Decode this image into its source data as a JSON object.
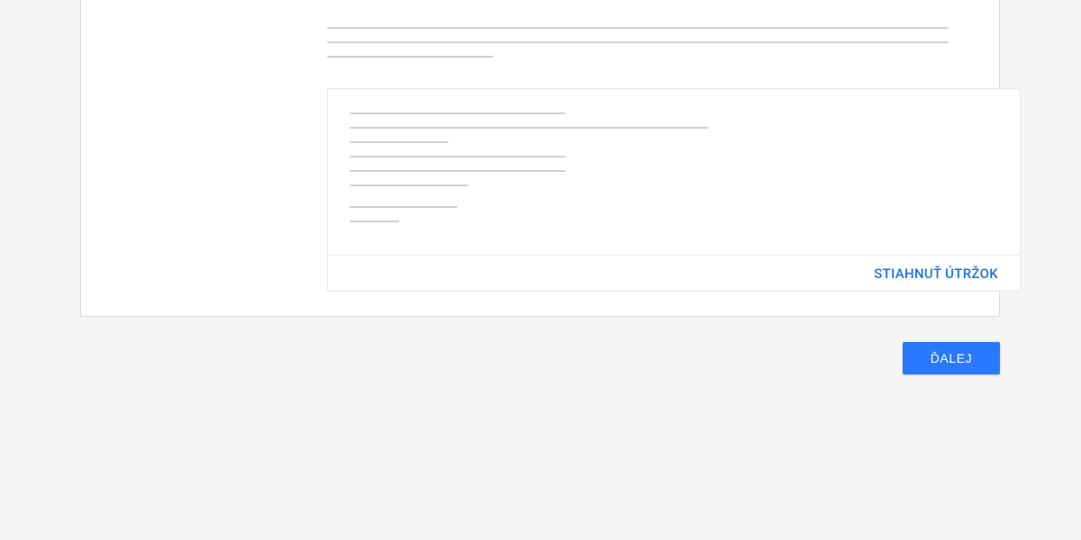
{
  "intro": {
    "lines": [
      690,
      690,
      185
    ]
  },
  "receipt": {
    "lines": [
      240,
      398,
      110,
      240,
      240,
      132,
      120,
      55
    ],
    "download_label": "STIAHNUŤ ÚTRŽOK"
  },
  "actions": {
    "next_label": "ĎALEJ"
  }
}
